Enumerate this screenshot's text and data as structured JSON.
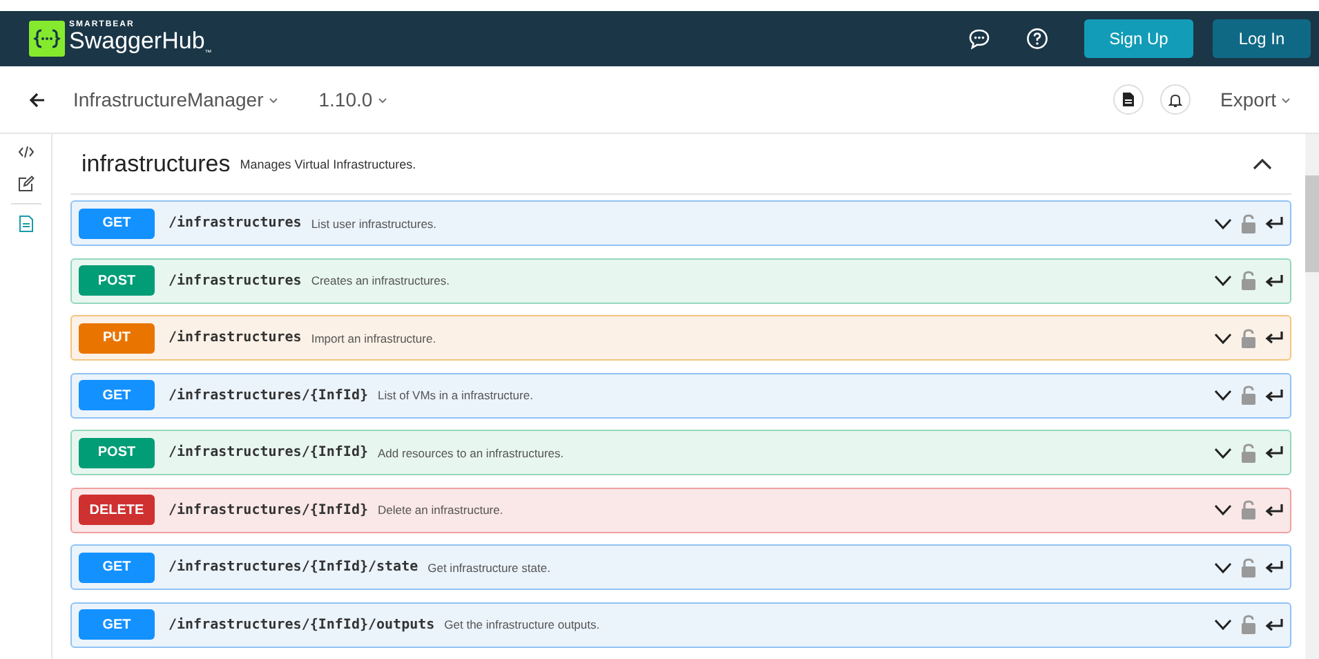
{
  "header": {
    "brand_small": "SMARTBEAR",
    "brand": "SwaggerHub",
    "brand_mark": "™",
    "sign_up": "Sign Up",
    "log_in": "Log In"
  },
  "subheader": {
    "api_name": "InfrastructureManager",
    "version": "1.10.0",
    "export": "Export"
  },
  "section": {
    "title": "infrastructures",
    "description": "Manages Virtual Infrastructures.",
    "expanded": true
  },
  "operations": [
    {
      "kind": "get",
      "method": "GET",
      "path": "/infrastructures",
      "summary": "List user infrastructures."
    },
    {
      "kind": "post",
      "method": "POST",
      "path": "/infrastructures",
      "summary": "Creates an infrastructures."
    },
    {
      "kind": "put",
      "method": "PUT",
      "path": "/infrastructures",
      "summary": "Import an infrastructure."
    },
    {
      "kind": "get",
      "method": "GET",
      "path": "/infrastructures/{InfId}",
      "summary": "List of VMs in a infrastructure."
    },
    {
      "kind": "post",
      "method": "POST",
      "path": "/infrastructures/{InfId}",
      "summary": "Add resources to an infrastructures."
    },
    {
      "kind": "delete",
      "method": "DELETE",
      "path": "/infrastructures/{InfId}",
      "summary": "Delete an infrastructure."
    },
    {
      "kind": "get",
      "method": "GET",
      "path": "/infrastructures/{InfId}/state",
      "summary": "Get infrastructure state."
    },
    {
      "kind": "get",
      "method": "GET",
      "path": "/infrastructures/{InfId}/outputs",
      "summary": "Get the infrastructure outputs."
    }
  ]
}
